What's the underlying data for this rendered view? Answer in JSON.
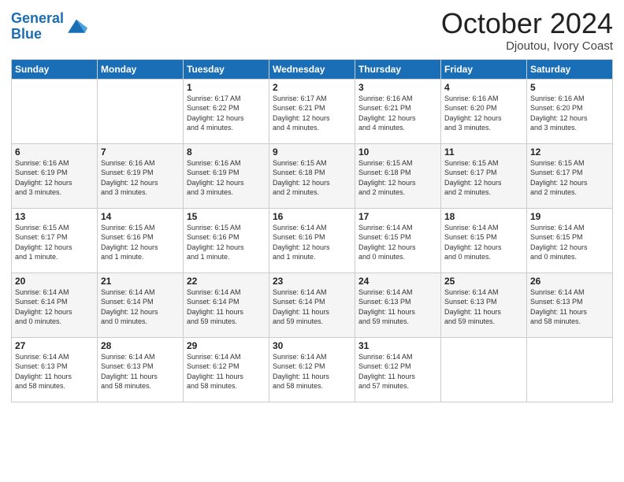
{
  "header": {
    "logo_line1": "General",
    "logo_line2": "Blue",
    "month": "October 2024",
    "location": "Djoutou, Ivory Coast"
  },
  "days_of_week": [
    "Sunday",
    "Monday",
    "Tuesday",
    "Wednesday",
    "Thursday",
    "Friday",
    "Saturday"
  ],
  "weeks": [
    [
      {
        "day": "",
        "info": ""
      },
      {
        "day": "",
        "info": ""
      },
      {
        "day": "1",
        "info": "Sunrise: 6:17 AM\nSunset: 6:22 PM\nDaylight: 12 hours\nand 4 minutes."
      },
      {
        "day": "2",
        "info": "Sunrise: 6:17 AM\nSunset: 6:21 PM\nDaylight: 12 hours\nand 4 minutes."
      },
      {
        "day": "3",
        "info": "Sunrise: 6:16 AM\nSunset: 6:21 PM\nDaylight: 12 hours\nand 4 minutes."
      },
      {
        "day": "4",
        "info": "Sunrise: 6:16 AM\nSunset: 6:20 PM\nDaylight: 12 hours\nand 3 minutes."
      },
      {
        "day": "5",
        "info": "Sunrise: 6:16 AM\nSunset: 6:20 PM\nDaylight: 12 hours\nand 3 minutes."
      }
    ],
    [
      {
        "day": "6",
        "info": "Sunrise: 6:16 AM\nSunset: 6:19 PM\nDaylight: 12 hours\nand 3 minutes."
      },
      {
        "day": "7",
        "info": "Sunrise: 6:16 AM\nSunset: 6:19 PM\nDaylight: 12 hours\nand 3 minutes."
      },
      {
        "day": "8",
        "info": "Sunrise: 6:16 AM\nSunset: 6:19 PM\nDaylight: 12 hours\nand 3 minutes."
      },
      {
        "day": "9",
        "info": "Sunrise: 6:15 AM\nSunset: 6:18 PM\nDaylight: 12 hours\nand 2 minutes."
      },
      {
        "day": "10",
        "info": "Sunrise: 6:15 AM\nSunset: 6:18 PM\nDaylight: 12 hours\nand 2 minutes."
      },
      {
        "day": "11",
        "info": "Sunrise: 6:15 AM\nSunset: 6:17 PM\nDaylight: 12 hours\nand 2 minutes."
      },
      {
        "day": "12",
        "info": "Sunrise: 6:15 AM\nSunset: 6:17 PM\nDaylight: 12 hours\nand 2 minutes."
      }
    ],
    [
      {
        "day": "13",
        "info": "Sunrise: 6:15 AM\nSunset: 6:17 PM\nDaylight: 12 hours\nand 1 minute."
      },
      {
        "day": "14",
        "info": "Sunrise: 6:15 AM\nSunset: 6:16 PM\nDaylight: 12 hours\nand 1 minute."
      },
      {
        "day": "15",
        "info": "Sunrise: 6:15 AM\nSunset: 6:16 PM\nDaylight: 12 hours\nand 1 minute."
      },
      {
        "day": "16",
        "info": "Sunrise: 6:14 AM\nSunset: 6:16 PM\nDaylight: 12 hours\nand 1 minute."
      },
      {
        "day": "17",
        "info": "Sunrise: 6:14 AM\nSunset: 6:15 PM\nDaylight: 12 hours\nand 0 minutes."
      },
      {
        "day": "18",
        "info": "Sunrise: 6:14 AM\nSunset: 6:15 PM\nDaylight: 12 hours\nand 0 minutes."
      },
      {
        "day": "19",
        "info": "Sunrise: 6:14 AM\nSunset: 6:15 PM\nDaylight: 12 hours\nand 0 minutes."
      }
    ],
    [
      {
        "day": "20",
        "info": "Sunrise: 6:14 AM\nSunset: 6:14 PM\nDaylight: 12 hours\nand 0 minutes."
      },
      {
        "day": "21",
        "info": "Sunrise: 6:14 AM\nSunset: 6:14 PM\nDaylight: 12 hours\nand 0 minutes."
      },
      {
        "day": "22",
        "info": "Sunrise: 6:14 AM\nSunset: 6:14 PM\nDaylight: 11 hours\nand 59 minutes."
      },
      {
        "day": "23",
        "info": "Sunrise: 6:14 AM\nSunset: 6:14 PM\nDaylight: 11 hours\nand 59 minutes."
      },
      {
        "day": "24",
        "info": "Sunrise: 6:14 AM\nSunset: 6:13 PM\nDaylight: 11 hours\nand 59 minutes."
      },
      {
        "day": "25",
        "info": "Sunrise: 6:14 AM\nSunset: 6:13 PM\nDaylight: 11 hours\nand 59 minutes."
      },
      {
        "day": "26",
        "info": "Sunrise: 6:14 AM\nSunset: 6:13 PM\nDaylight: 11 hours\nand 58 minutes."
      }
    ],
    [
      {
        "day": "27",
        "info": "Sunrise: 6:14 AM\nSunset: 6:13 PM\nDaylight: 11 hours\nand 58 minutes."
      },
      {
        "day": "28",
        "info": "Sunrise: 6:14 AM\nSunset: 6:13 PM\nDaylight: 11 hours\nand 58 minutes."
      },
      {
        "day": "29",
        "info": "Sunrise: 6:14 AM\nSunset: 6:12 PM\nDaylight: 11 hours\nand 58 minutes."
      },
      {
        "day": "30",
        "info": "Sunrise: 6:14 AM\nSunset: 6:12 PM\nDaylight: 11 hours\nand 58 minutes."
      },
      {
        "day": "31",
        "info": "Sunrise: 6:14 AM\nSunset: 6:12 PM\nDaylight: 11 hours\nand 57 minutes."
      },
      {
        "day": "",
        "info": ""
      },
      {
        "day": "",
        "info": ""
      }
    ]
  ]
}
